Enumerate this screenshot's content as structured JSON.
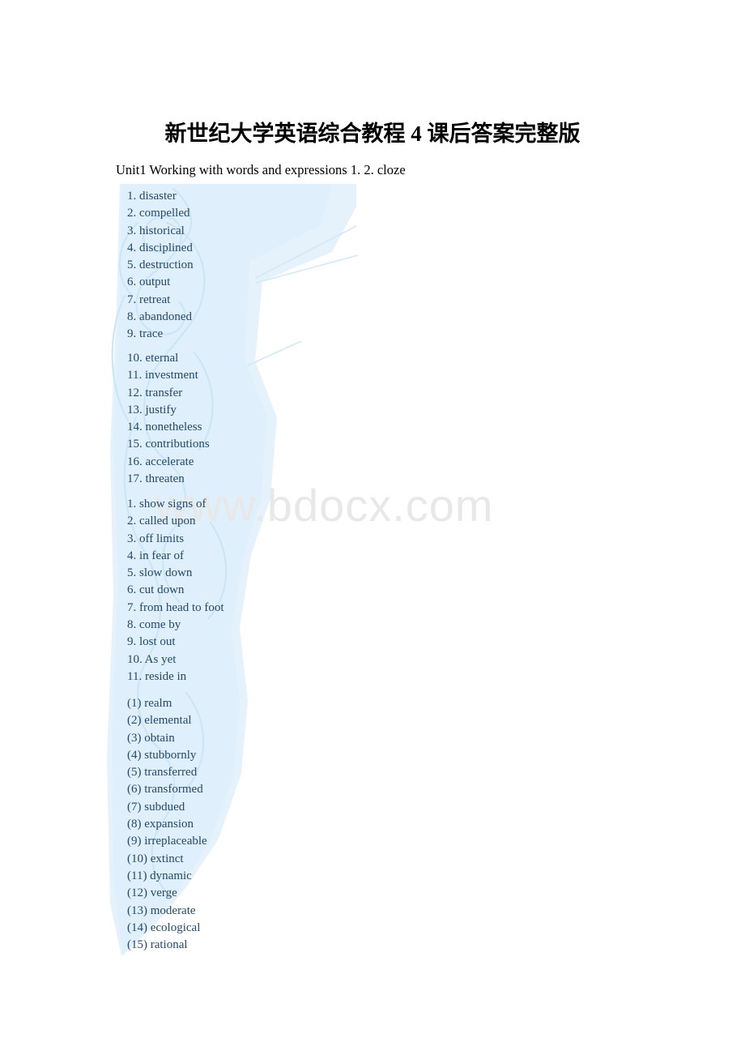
{
  "document": {
    "title": "新世纪大学英语综合教程 4 课后答案完整版",
    "unit_line": "Unit1 Working with words and expressions 1. 2. cloze"
  },
  "watermark": {
    "text": "www.bdocx.com",
    "shape_color": "#e4f1fa",
    "text_color": "#e8e8e8"
  },
  "colors": {
    "answer_text": "#24496b",
    "body_text": "#000000",
    "page_background": "#ffffff"
  },
  "answers": {
    "block_a": [
      "1. disaster",
      "2. compelled",
      "3. historical",
      "4. disciplined",
      "5. destruction",
      "6. output",
      "7. retreat",
      "8. abandoned",
      "9. trace"
    ],
    "block_b": [
      "10. eternal",
      "11. investment",
      "12. transfer",
      "13. justify",
      "14. nonetheless",
      "15. contributions",
      "16. accelerate",
      "17. threaten"
    ],
    "block_c": [
      "1. show signs of",
      "2. called upon",
      "3. off limits",
      "4. in fear of",
      "5. slow down",
      "6. cut down",
      "7. from head to foot",
      "8. come by",
      "9. lost out",
      "10. As yet",
      "11. reside in"
    ],
    "block_d": [
      "(1) realm",
      "(2) elemental",
      "(3) obtain",
      "(4) stubbornly",
      "(5) transferred",
      "(6) transformed",
      "(7) subdued",
      "(8) expansion",
      "(9) irreplaceable",
      "(10) extinct",
      "(11) dynamic",
      "(12) verge",
      "(13) moderate",
      "(14) ecological",
      "(15) rational"
    ]
  }
}
